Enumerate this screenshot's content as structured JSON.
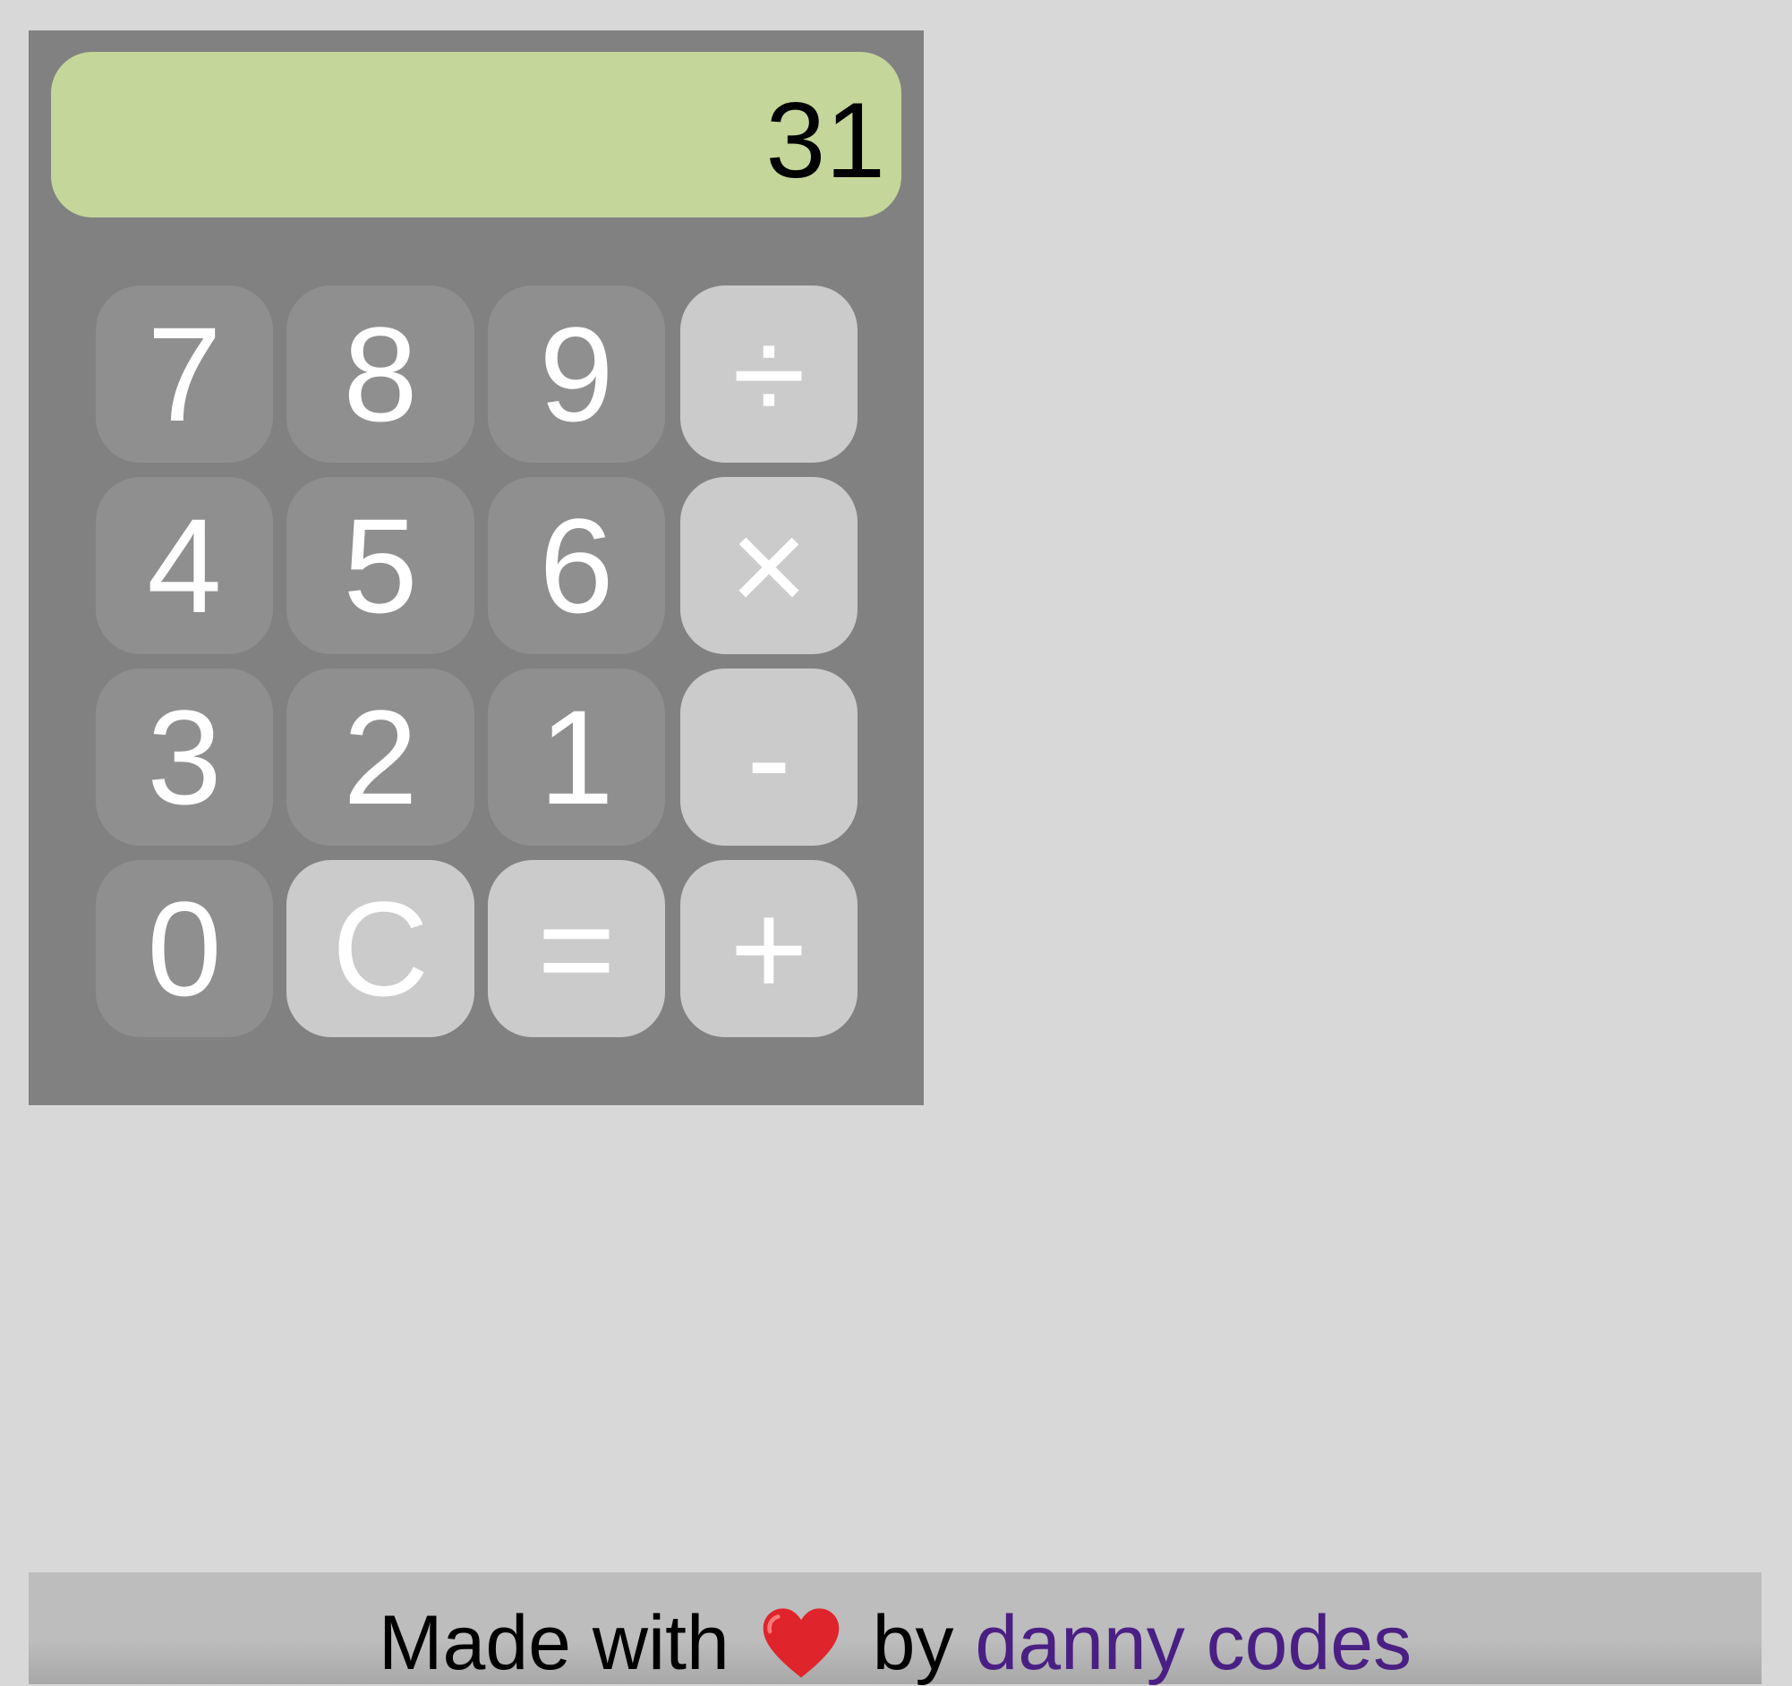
{
  "calculator": {
    "display_value": "31",
    "keys": [
      {
        "label": "7",
        "kind": "digit"
      },
      {
        "label": "8",
        "kind": "digit"
      },
      {
        "label": "9",
        "kind": "digit"
      },
      {
        "label": "÷",
        "kind": "operator"
      },
      {
        "label": "4",
        "kind": "digit"
      },
      {
        "label": "5",
        "kind": "digit"
      },
      {
        "label": "6",
        "kind": "digit"
      },
      {
        "label": "×",
        "kind": "operator"
      },
      {
        "label": "3",
        "kind": "digit"
      },
      {
        "label": "2",
        "kind": "digit"
      },
      {
        "label": "1",
        "kind": "digit"
      },
      {
        "label": "-",
        "kind": "operator"
      },
      {
        "label": "0",
        "kind": "digit"
      },
      {
        "label": "C",
        "kind": "operator"
      },
      {
        "label": "=",
        "kind": "operator"
      },
      {
        "label": "+",
        "kind": "operator"
      }
    ]
  },
  "footer": {
    "prefix": "Made with",
    "heart_icon": "heart-icon",
    "middle": "by",
    "link_text": "danny codes"
  },
  "colors": {
    "page_background": "#d8d8d8",
    "calculator_body": "#818181",
    "display_background": "#c5d69b",
    "digit_key": "#8f8f8f",
    "operator_key": "#cbcbcb",
    "link": "#4a1f84",
    "heart": "#e0242b"
  }
}
